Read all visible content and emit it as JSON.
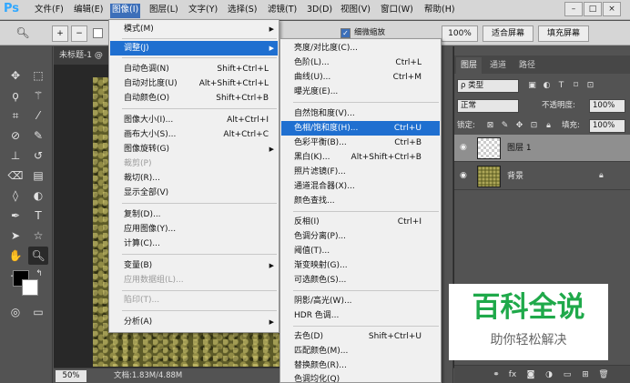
{
  "app": {
    "logo": "Ps"
  },
  "menubar": {
    "items": [
      "文件(F)",
      "编辑(E)",
      "图像(I)",
      "图层(L)",
      "文字(Y)",
      "选择(S)",
      "滤镜(T)",
      "3D(D)",
      "视图(V)",
      "窗口(W)",
      "帮助(H)"
    ],
    "active": "图像(I)"
  },
  "window_controls": {
    "minimize": "–",
    "restore": "□",
    "close": "×"
  },
  "options_bar": {
    "scrubby_zoom": "细微缩放",
    "zoom_value": "100%",
    "fit_screen": "适合屏幕",
    "fill_screen": "填充屏幕"
  },
  "document": {
    "tab_title": "未标题-1 @",
    "zoom": "50%",
    "info": "文档:1.83M/4.88M"
  },
  "image_menu": {
    "items": [
      {
        "label": "模式(M)",
        "shortcut": "",
        "submenu": true
      },
      {
        "label": "调整(J)",
        "shortcut": "",
        "submenu": true,
        "highlight": true
      },
      {
        "label": "自动色调(N)",
        "shortcut": "Shift+Ctrl+L"
      },
      {
        "label": "自动对比度(U)",
        "shortcut": "Alt+Shift+Ctrl+L"
      },
      {
        "label": "自动颜色(O)",
        "shortcut": "Shift+Ctrl+B"
      },
      {
        "label": "图像大小(I)...",
        "shortcut": "Alt+Ctrl+I"
      },
      {
        "label": "画布大小(S)...",
        "shortcut": "Alt+Ctrl+C"
      },
      {
        "label": "图像旋转(G)",
        "shortcut": "",
        "submenu": true
      },
      {
        "label": "裁剪(P)",
        "shortcut": "",
        "disabled": true
      },
      {
        "label": "裁切(R)...",
        "shortcut": ""
      },
      {
        "label": "显示全部(V)",
        "shortcut": ""
      },
      {
        "label": "复制(D)...",
        "shortcut": ""
      },
      {
        "label": "应用图像(Y)...",
        "shortcut": ""
      },
      {
        "label": "计算(C)...",
        "shortcut": ""
      },
      {
        "label": "变量(B)",
        "shortcut": "",
        "submenu": true
      },
      {
        "label": "应用数据组(L)...",
        "shortcut": "",
        "disabled": true
      },
      {
        "label": "陷印(T)...",
        "shortcut": "",
        "disabled": true
      },
      {
        "label": "分析(A)",
        "shortcut": "",
        "submenu": true
      }
    ]
  },
  "adjust_menu": {
    "items": [
      {
        "label": "亮度/对比度(C)...",
        "shortcut": ""
      },
      {
        "label": "色阶(L)...",
        "shortcut": "Ctrl+L"
      },
      {
        "label": "曲线(U)...",
        "shortcut": "Ctrl+M"
      },
      {
        "label": "曝光度(E)...",
        "shortcut": ""
      },
      {
        "label": "自然饱和度(V)...",
        "shortcut": ""
      },
      {
        "label": "色相/饱和度(H)...",
        "shortcut": "Ctrl+U",
        "highlight": true
      },
      {
        "label": "色彩平衡(B)...",
        "shortcut": "Ctrl+B"
      },
      {
        "label": "黑白(K)...",
        "shortcut": "Alt+Shift+Ctrl+B"
      },
      {
        "label": "照片滤镜(F)...",
        "shortcut": ""
      },
      {
        "label": "通道混合器(X)...",
        "shortcut": ""
      },
      {
        "label": "颜色查找...",
        "shortcut": ""
      },
      {
        "label": "反相(I)",
        "shortcut": "Ctrl+I"
      },
      {
        "label": "色调分离(P)...",
        "shortcut": ""
      },
      {
        "label": "阈值(T)...",
        "shortcut": ""
      },
      {
        "label": "渐变映射(G)...",
        "shortcut": ""
      },
      {
        "label": "可选颜色(S)...",
        "shortcut": ""
      },
      {
        "label": "阴影/高光(W)...",
        "shortcut": ""
      },
      {
        "label": "HDR 色调...",
        "shortcut": ""
      },
      {
        "label": "去色(D)",
        "shortcut": "Shift+Ctrl+U"
      },
      {
        "label": "匹配颜色(M)...",
        "shortcut": ""
      },
      {
        "label": "替换颜色(R)...",
        "shortcut": ""
      },
      {
        "label": "色调均化(Q)",
        "shortcut": ""
      }
    ]
  },
  "layers_panel": {
    "tabs": [
      "图层",
      "通道",
      "路径"
    ],
    "active_tab": "图层",
    "filter_kind": "ρ 类型",
    "blend_mode": "正常",
    "opacity_label": "不透明度:",
    "opacity_value": "100%",
    "lock_label": "锁定:",
    "fill_label": "填充:",
    "fill_value": "100%",
    "layers": [
      {
        "name": "图层 1",
        "selected": true
      },
      {
        "name": "背景",
        "selected": false,
        "locked": true
      }
    ]
  },
  "watermark": {
    "title": "百科全说",
    "subtitle": "助你轻松解决"
  },
  "colors": {
    "menu_highlight": "#1f6fd0",
    "ps_blue": "#31a8ff",
    "watermark_green": "#1fa94a"
  }
}
